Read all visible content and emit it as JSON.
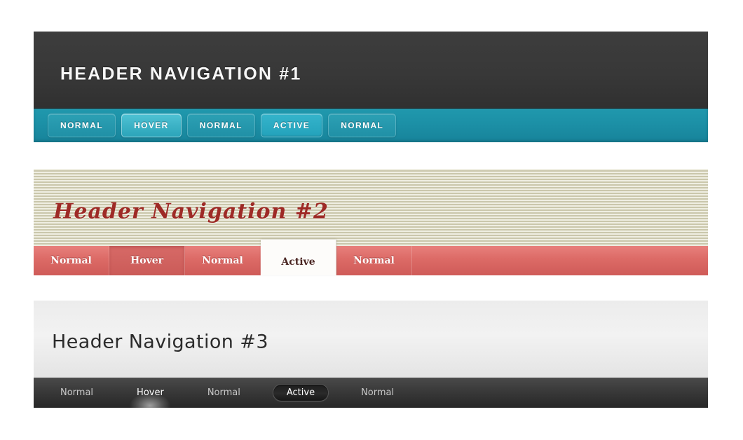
{
  "sections": [
    {
      "id": "header-navigation-1",
      "title": "HEADER NAVIGATION #1",
      "style": {
        "header_bg": "#3a3a3a",
        "nav_bg": "#1c90a6",
        "text_color": "#f7f7f7",
        "button_active_bg": "#2aa8bf"
      },
      "nav": [
        {
          "label": "NORMAL",
          "state": "normal"
        },
        {
          "label": "HOVER",
          "state": "hover"
        },
        {
          "label": "NORMAL",
          "state": "normal"
        },
        {
          "label": "ACTIVE",
          "state": "active"
        },
        {
          "label": "NORMAL",
          "state": "normal"
        }
      ]
    },
    {
      "id": "header-navigation-2",
      "title": "Header Navigation #2",
      "style": {
        "header_bg": "#dcd9bf",
        "nav_bg": "#dc6a66",
        "text_color": "#9e2a26",
        "tab_active_bg": "#fdfcfa"
      },
      "nav": [
        {
          "label": "Normal",
          "state": "normal"
        },
        {
          "label": "Hover",
          "state": "hover"
        },
        {
          "label": "Normal",
          "state": "normal"
        },
        {
          "label": "Active",
          "state": "active"
        },
        {
          "label": "Normal",
          "state": "normal"
        }
      ]
    },
    {
      "id": "header-navigation-3",
      "title": "Header Navigation #3",
      "style": {
        "header_bg": "#ececec",
        "nav_bg": "#3b3b3b",
        "text_color": "#2b2b2b",
        "item_active_bg": "#1d1d1d"
      },
      "nav": [
        {
          "label": "Normal",
          "state": "normal"
        },
        {
          "label": "Hover",
          "state": "hover"
        },
        {
          "label": "Normal",
          "state": "normal"
        },
        {
          "label": "Active",
          "state": "active"
        },
        {
          "label": "Normal",
          "state": "normal"
        }
      ]
    }
  ]
}
